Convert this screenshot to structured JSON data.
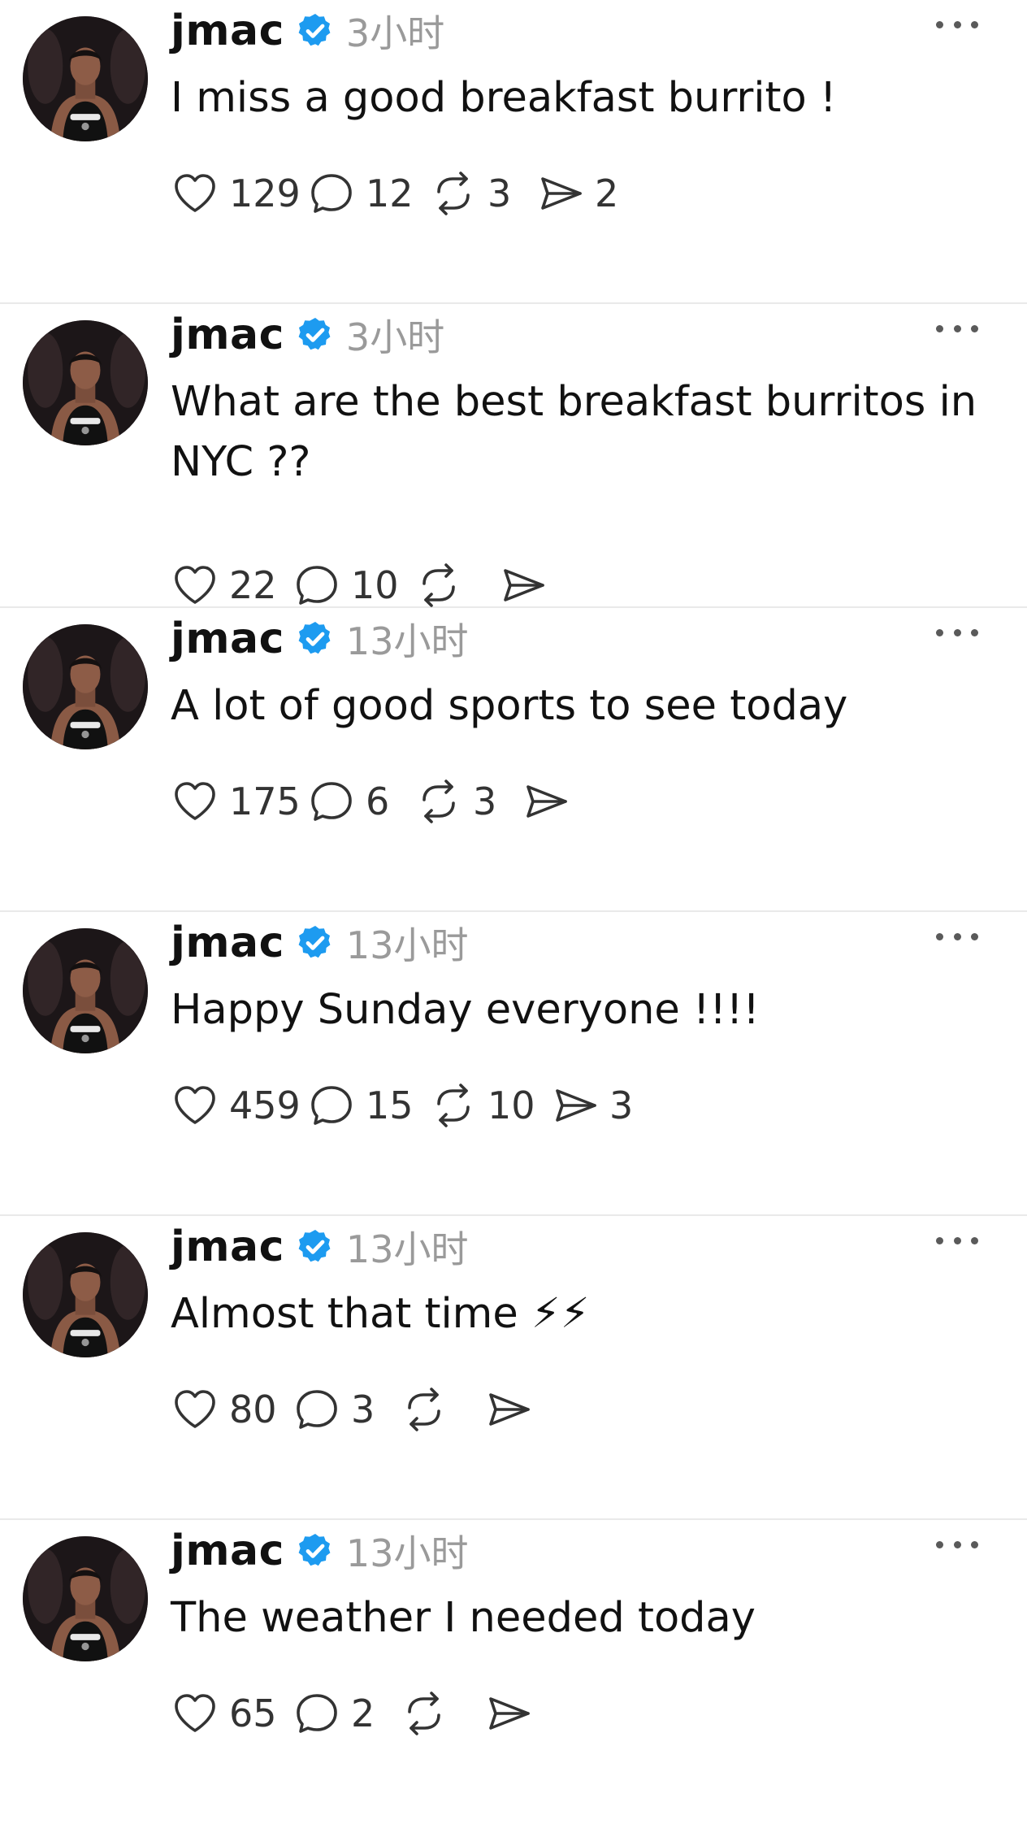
{
  "colors": {
    "verified_blue": "#1d9bf0",
    "timestamp_gray": "#9a9a9a",
    "divider": "#e9e9e9"
  },
  "icons": {
    "like": "heart-icon",
    "reply": "comment-bubble-icon",
    "repost": "repost-arrows-icon",
    "share": "send-paper-plane-icon",
    "more": "more-dots-icon",
    "verified": "verified-badge-icon"
  },
  "posts": [
    {
      "username": "jmac",
      "time": "3小时",
      "text": "I miss a good breakfast burrito !",
      "likes": "129",
      "replies": "12",
      "reposts": "3",
      "shares": "2"
    },
    {
      "username": "jmac",
      "time": "3小时",
      "text": "What are the best breakfast burritos in NYC ??",
      "likes": "22",
      "replies": "10",
      "reposts": "",
      "shares": ""
    },
    {
      "username": "jmac",
      "time": "13小时",
      "text": "A lot of good sports to see today",
      "likes": "175",
      "replies": "6",
      "reposts": "3",
      "shares": ""
    },
    {
      "username": "jmac",
      "time": "13小时",
      "text": "Happy Sunday everyone !!!!",
      "likes": "459",
      "replies": "15",
      "reposts": "10",
      "shares": "3"
    },
    {
      "username": "jmac",
      "time": "13小时",
      "text": "Almost that time ⚡⚡",
      "likes": "80",
      "replies": "3",
      "reposts": "",
      "shares": ""
    },
    {
      "username": "jmac",
      "time": "13小时",
      "text": "The weather I needed today",
      "likes": "65",
      "replies": "2",
      "reposts": "",
      "shares": ""
    }
  ]
}
